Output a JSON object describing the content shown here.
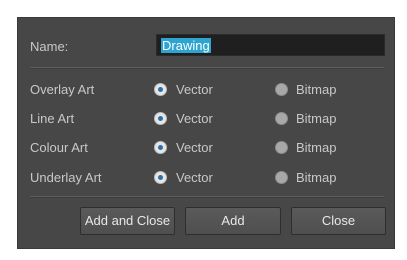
{
  "name_field": {
    "label": "Name:",
    "value": "Drawing"
  },
  "rows": [
    {
      "label": "Overlay Art",
      "selected": "Vector"
    },
    {
      "label": "Line Art",
      "selected": "Vector"
    },
    {
      "label": "Colour Art",
      "selected": "Vector"
    },
    {
      "label": "Underlay Art",
      "selected": "Vector"
    }
  ],
  "options": {
    "vector": "Vector",
    "bitmap": "Bitmap"
  },
  "buttons": {
    "add_and_close": "Add and Close",
    "add": "Add",
    "close": "Close"
  }
}
